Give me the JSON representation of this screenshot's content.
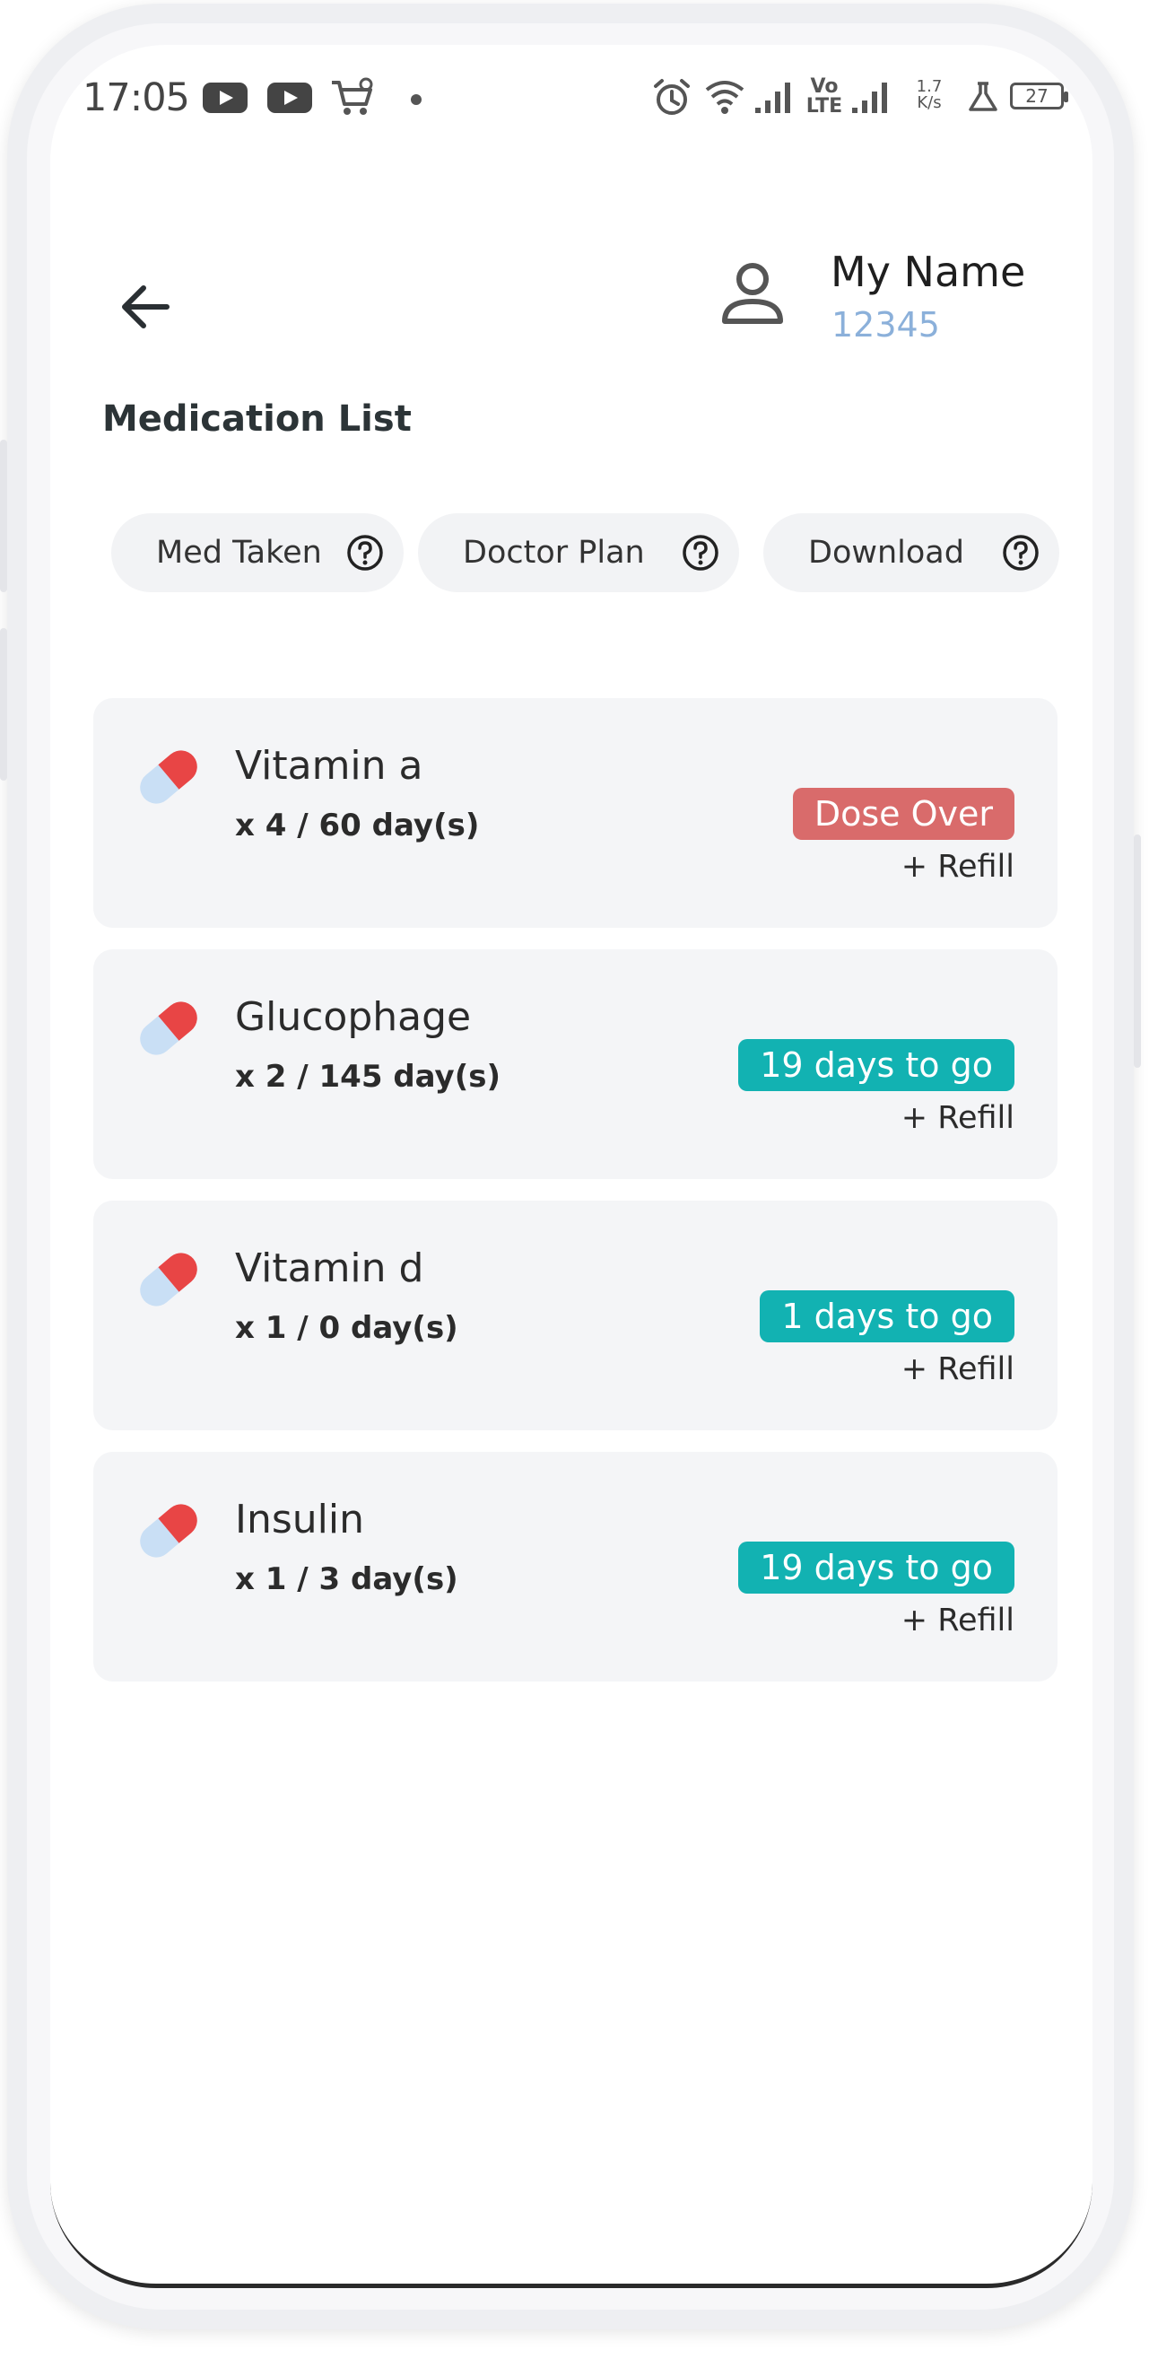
{
  "status_bar": {
    "time": "17:05",
    "speed_value": "1.7",
    "speed_unit": "K/s",
    "lte_top": "Vo",
    "lte_bottom": "LTE",
    "battery": "27"
  },
  "header": {
    "user_name": "My Name",
    "user_id": "12345",
    "title": "Medication List"
  },
  "chips": [
    {
      "label": "Med Taken"
    },
    {
      "label": "Doctor Plan"
    },
    {
      "label": "Download"
    }
  ],
  "medications": [
    {
      "name": "Vitamin a",
      "dose": "x 4 / 60 day(s)",
      "status": "Dose Over",
      "status_color": "#d96b6b",
      "refill_label": "+ Refill"
    },
    {
      "name": "Glucophage",
      "dose": "x 2 / 145 day(s)",
      "status": "19 days to go",
      "status_color": "#12b2b2",
      "refill_label": "+ Refill"
    },
    {
      "name": "Vitamin d",
      "dose": "x 1 / 0 day(s)",
      "status": "1 days to go",
      "status_color": "#12b2b2",
      "refill_label": "+ Refill"
    },
    {
      "name": "Insulin",
      "dose": "x 1 / 3 day(s)",
      "status": "19 days to go",
      "status_color": "#12b2b2",
      "refill_label": "+ Refill"
    }
  ],
  "colors": {
    "accent_teal": "#12b2b2",
    "alert_red": "#d96b6b",
    "user_id_blue": "#8bb0da",
    "card_bg": "#f4f5f7"
  }
}
